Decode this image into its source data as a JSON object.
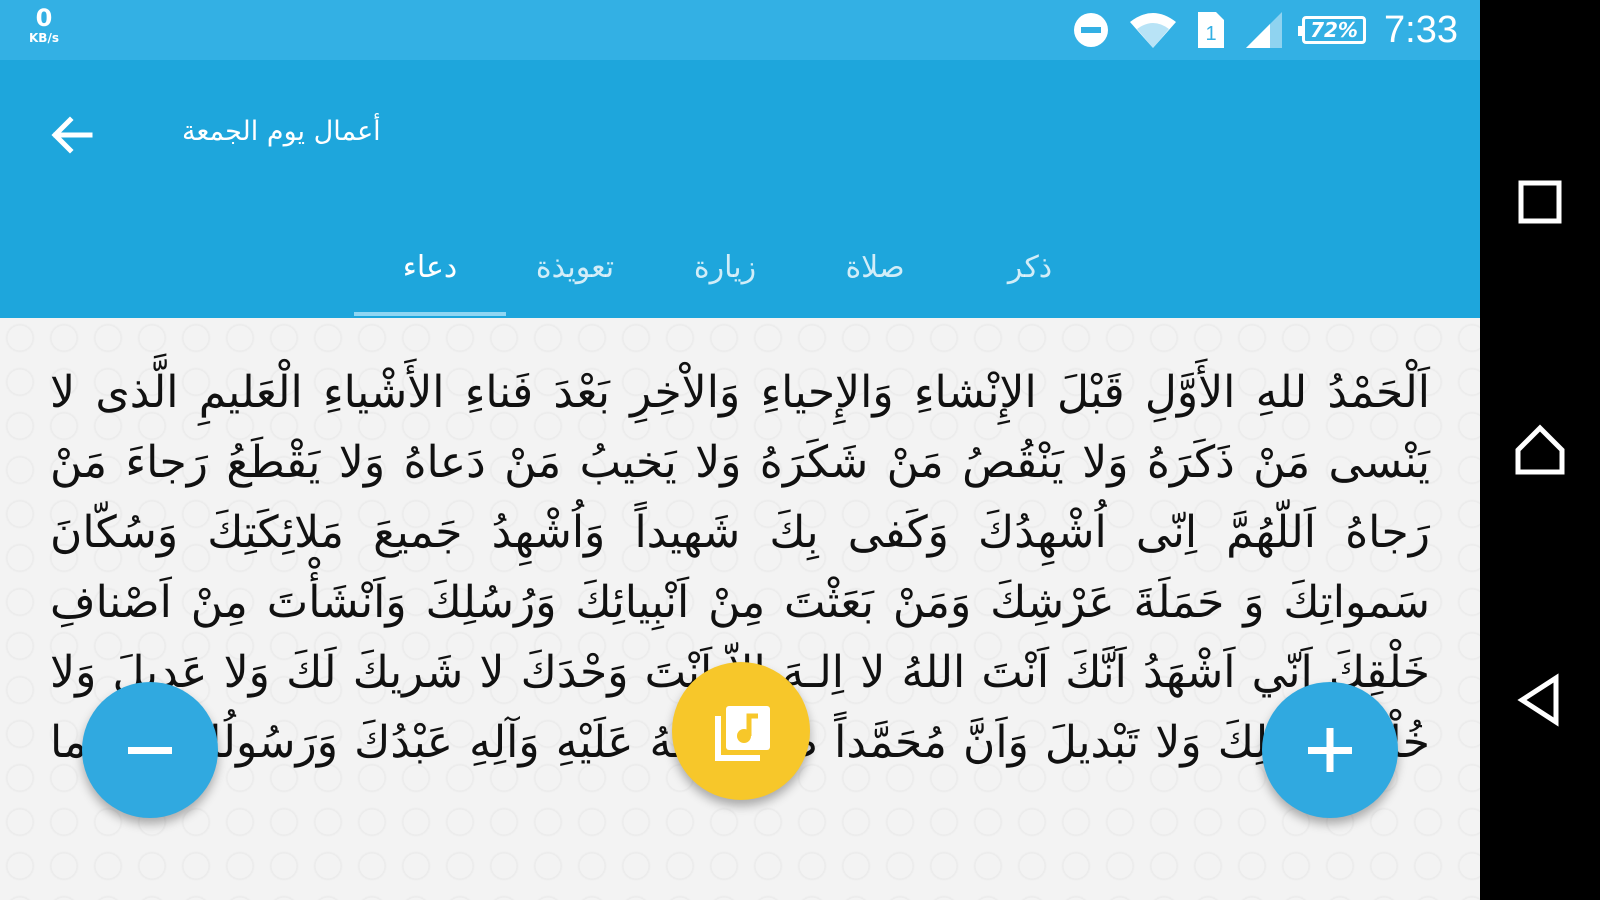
{
  "status_bar": {
    "net_speed_value": "0",
    "net_speed_unit": "KB/s",
    "battery_percent": "72%",
    "time": "7:33",
    "icons": [
      "do-not-disturb-icon",
      "wifi-icon",
      "sim-icon",
      "signal-icon",
      "battery-icon"
    ]
  },
  "app_bar": {
    "title": "أعمال يوم الجمعة",
    "back_icon": "arrow-back-icon"
  },
  "tabs": [
    {
      "label": "دعاء",
      "active": true
    },
    {
      "label": "تعويذة",
      "active": false
    },
    {
      "label": "زيارة",
      "active": false
    },
    {
      "label": "صلاة",
      "active": false
    },
    {
      "label": "ذكر",
      "active": false
    }
  ],
  "content": {
    "dua_text": "اَلْحَمْدُ للهِ الأَوَّلِ قَبْلَ الإِنْشاءِ وَالإِحياءِ وَالاْخِرِ بَعْدَ فَناءِ الأَشْياءِ الْعَليمِ الَّذى لا يَنْسى مَنْ ذَكَرَهُ وَلا يَنْقُصُ مَنْ شَكَرَهُ وَلا يَخيبُ مَنْ دَعاهُ وَلا يَقْطَعُ رَجاءَ مَنْ رَجاهُ اَللّهُمَّ اِنّى اُشْهِدُكَ وَكَفى بِكَ شَهيداً وَاُشْهِدُ جَميعَ مَلائِكَتِكَ وَسُكّانَ سَمواتِكَ وَ حَمَلَةَ عَرْشِكَ وَمَنْ بَعَثْتَ مِنْ اَنْبِيائِكَ وَرُسُلِكَ وَاَنْشَأْتَ مِنْ اَصْنافِ خَلْقِكَ اَنّي اَشْهَدُ اَنَّكَ اَنْتَ اللهُ لا اِلـهَ اِلاّ اَنْتَ وَحْدَكَ لا شَريكَ لَكَ وَلا عَديلَ وَلا خُلْفَ لِقَوْلِكَ وَلا تَبْديلَ وَاَنَّ مُحَمَّداً صَلَّى اللهُ عَلَيْهِ وَآلِهِ عَبْدُكَ وَرَسُولُكَ اَدّى ما"
  },
  "fabs": {
    "decrease_icon": "minus-icon",
    "audio_icon": "music-library-icon",
    "increase_icon": "plus-icon"
  },
  "nav_bar": {
    "icons": [
      "recents-square-icon",
      "home-icon",
      "back-triangle-icon"
    ]
  },
  "colors": {
    "status_bar": "#33b0e4",
    "app_bar": "#1ea6dc",
    "fab_blue": "#30a9e0",
    "fab_yellow": "#f7c72a",
    "content_bg": "#f3f3f3"
  }
}
